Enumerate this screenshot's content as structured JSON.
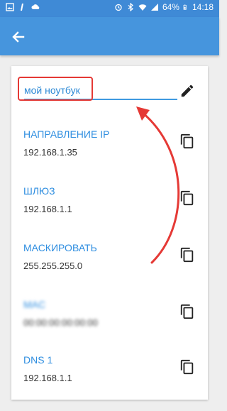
{
  "status_bar": {
    "battery": "64%",
    "time": "14:18"
  },
  "app_bar": {
    "back_icon": "arrow-left-icon"
  },
  "device_name": {
    "value": "мой ноутбук"
  },
  "fields": [
    {
      "label": "НАПРАВЛЕНИЕ IP",
      "value": "192.168.1.35"
    },
    {
      "label": "ШЛЮЗ",
      "value": "192.168.1.1"
    },
    {
      "label": "МАСКИРОВАТЬ",
      "value": "255.255.255.0"
    },
    {
      "label": "MAC",
      "value": "00:00:00:00:00:00"
    },
    {
      "label": "DNS 1",
      "value": "192.168.1.1"
    }
  ],
  "colors": {
    "status_bar": "#3f8ad6",
    "app_bar": "#4695dd",
    "label_blue": "#2f8ee0",
    "annotation_red": "#e53935"
  }
}
